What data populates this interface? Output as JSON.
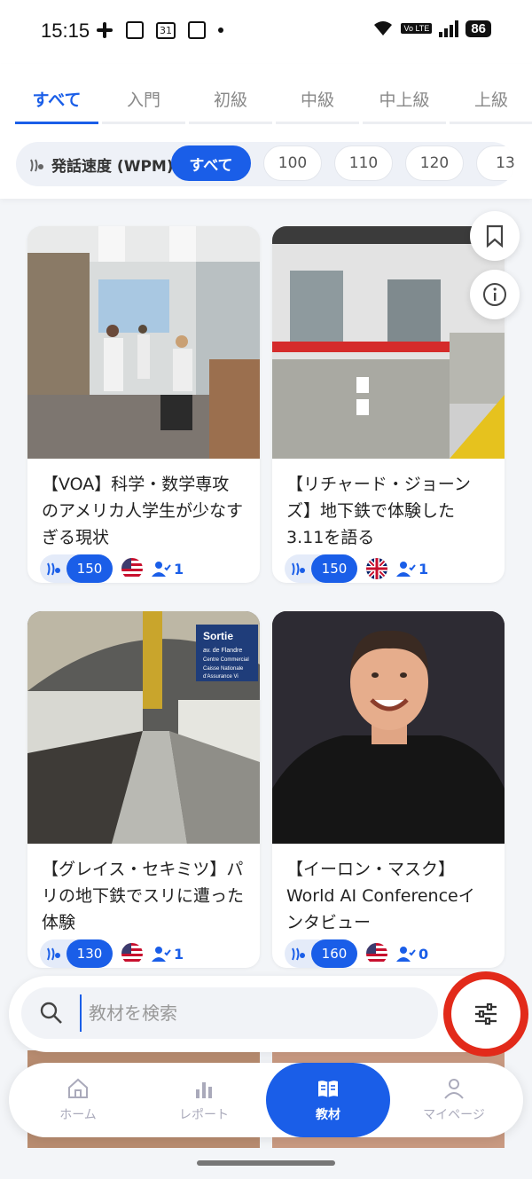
{
  "status": {
    "time": "15:15",
    "battery": "86",
    "volte": "Vo LTE",
    "calendar_day": "31"
  },
  "tabs": [
    "すべて",
    "入門",
    "初級",
    "中級",
    "中上級",
    "上級"
  ],
  "speed": {
    "label": "発話速度 (WPM)",
    "chips": [
      "すべて",
      "100",
      "110",
      "120",
      "13"
    ]
  },
  "cards": [
    {
      "title": "【VOA】科学・数学専攻のアメリカ人学生が少なすぎる現状",
      "wpm": "150",
      "flag": "us-flag-icon",
      "learners": "1"
    },
    {
      "title": "【リチャード・ジョーンズ】地下鉄で体験した3.11を語る",
      "wpm": "150",
      "flag": "uk-flag-icon",
      "learners": "1"
    },
    {
      "title": "【グレイス・セキミツ】パリの地下鉄でスリに遭った体験",
      "wpm": "130",
      "flag": "us-flag-icon",
      "learners": "1"
    },
    {
      "title": "【イーロン・マスク】World AI Conferenceインタビュー",
      "wpm": "160",
      "flag": "us-flag-icon",
      "learners": "0"
    }
  ],
  "sign": {
    "title": "Sortie",
    "rows": [
      "av. de Flandre",
      "Centre Commercial",
      "Caisse Nationale",
      "d'Assurance Vi"
    ]
  },
  "search": {
    "placeholder": "教材を検索"
  },
  "nav": {
    "home": "ホーム",
    "report": "レポート",
    "materials": "教材",
    "mypage": "マイページ"
  },
  "colors": {
    "accent": "#1a5ee8",
    "highlight": "#e22a1a"
  }
}
